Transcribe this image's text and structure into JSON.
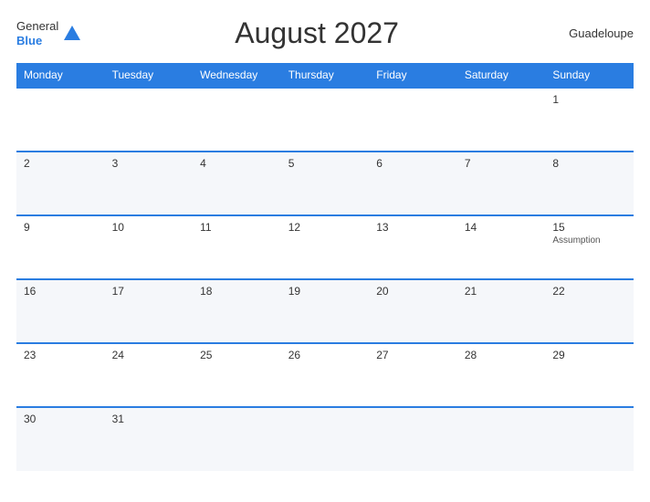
{
  "header": {
    "title": "August 2027",
    "region": "Guadeloupe",
    "logo_general": "General",
    "logo_blue": "Blue"
  },
  "weekdays": [
    "Monday",
    "Tuesday",
    "Wednesday",
    "Thursday",
    "Friday",
    "Saturday",
    "Sunday"
  ],
  "weeks": [
    [
      {
        "day": "",
        "holiday": ""
      },
      {
        "day": "",
        "holiday": ""
      },
      {
        "day": "",
        "holiday": ""
      },
      {
        "day": "",
        "holiday": ""
      },
      {
        "day": "",
        "holiday": ""
      },
      {
        "day": "",
        "holiday": ""
      },
      {
        "day": "1",
        "holiday": ""
      }
    ],
    [
      {
        "day": "2",
        "holiday": ""
      },
      {
        "day": "3",
        "holiday": ""
      },
      {
        "day": "4",
        "holiday": ""
      },
      {
        "day": "5",
        "holiday": ""
      },
      {
        "day": "6",
        "holiday": ""
      },
      {
        "day": "7",
        "holiday": ""
      },
      {
        "day": "8",
        "holiday": ""
      }
    ],
    [
      {
        "day": "9",
        "holiday": ""
      },
      {
        "day": "10",
        "holiday": ""
      },
      {
        "day": "11",
        "holiday": ""
      },
      {
        "day": "12",
        "holiday": ""
      },
      {
        "day": "13",
        "holiday": ""
      },
      {
        "day": "14",
        "holiday": ""
      },
      {
        "day": "15",
        "holiday": "Assumption"
      }
    ],
    [
      {
        "day": "16",
        "holiday": ""
      },
      {
        "day": "17",
        "holiday": ""
      },
      {
        "day": "18",
        "holiday": ""
      },
      {
        "day": "19",
        "holiday": ""
      },
      {
        "day": "20",
        "holiday": ""
      },
      {
        "day": "21",
        "holiday": ""
      },
      {
        "day": "22",
        "holiday": ""
      }
    ],
    [
      {
        "day": "23",
        "holiday": ""
      },
      {
        "day": "24",
        "holiday": ""
      },
      {
        "day": "25",
        "holiday": ""
      },
      {
        "day": "26",
        "holiday": ""
      },
      {
        "day": "27",
        "holiday": ""
      },
      {
        "day": "28",
        "holiday": ""
      },
      {
        "day": "29",
        "holiday": ""
      }
    ],
    [
      {
        "day": "30",
        "holiday": ""
      },
      {
        "day": "31",
        "holiday": ""
      },
      {
        "day": "",
        "holiday": ""
      },
      {
        "day": "",
        "holiday": ""
      },
      {
        "day": "",
        "holiday": ""
      },
      {
        "day": "",
        "holiday": ""
      },
      {
        "day": "",
        "holiday": ""
      }
    ]
  ],
  "accent_color": "#2a7de1"
}
